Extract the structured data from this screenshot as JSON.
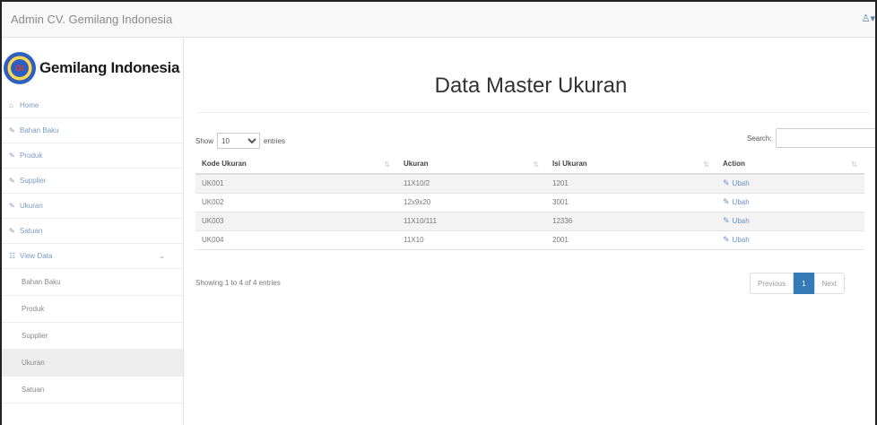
{
  "topbar": {
    "brand": "Admin CV. Gemilang Indonesia",
    "user_icon": "user-icon",
    "user_caret": "caret-down-icon"
  },
  "sidebar": {
    "logo_text": "Gemilang Indonesia",
    "logo_mark": "GI",
    "items": [
      {
        "label": "Home",
        "icon": "home-icon"
      },
      {
        "label": "Bahan Baku",
        "icon": "edit-icon"
      },
      {
        "label": "Produk",
        "icon": "edit-icon"
      },
      {
        "label": "Supplier",
        "icon": "edit-icon"
      },
      {
        "label": "Ukuran",
        "icon": "edit-icon"
      },
      {
        "label": "Satuan",
        "icon": "edit-icon"
      },
      {
        "label": "View Data",
        "icon": "sitemap-icon"
      }
    ],
    "subitems": [
      {
        "label": "Bahan Baku"
      },
      {
        "label": "Produk"
      },
      {
        "label": "Supplier"
      },
      {
        "label": "Ukuran",
        "active": true
      },
      {
        "label": "Satuan"
      }
    ]
  },
  "main": {
    "title": "Data Master Ukuran",
    "length": {
      "prefix": "Show",
      "value": "10",
      "suffix": "entries"
    },
    "search": {
      "label": "Search:",
      "value": ""
    },
    "columns": [
      "Kode Ukuran",
      "Ukuran",
      "Isi Ukuran",
      "Action"
    ],
    "rows": [
      {
        "kode": "UK001",
        "ukuran": "11X10/2",
        "isi": "1201",
        "action": "Ubah"
      },
      {
        "kode": "UK002",
        "ukuran": "12x9x20",
        "isi": "3001",
        "action": "Ubah"
      },
      {
        "kode": "UK003",
        "ukuran": "11X10/111",
        "isi": "12336",
        "action": "Ubah"
      },
      {
        "kode": "UK004",
        "ukuran": "11X10",
        "isi": "2001",
        "action": "Ubah"
      }
    ],
    "info": "Showing 1 to 4 of 4 entries",
    "pager": {
      "prev": "Previous",
      "current": "1",
      "next": "Next"
    }
  }
}
